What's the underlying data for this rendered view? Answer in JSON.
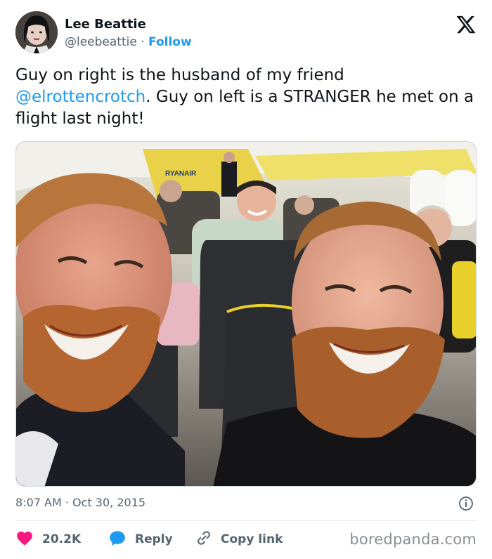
{
  "author": {
    "name": "Lee Beattie",
    "handle": "@leebeattie",
    "separator": "·",
    "follow_label": "Follow"
  },
  "tweet": {
    "text_part1": "Guy on right is the husband of my friend ",
    "mention": "@elrottencrotch",
    "text_part2": ". Guy on left is a STRANGER he met on a flight last night!"
  },
  "meta": {
    "time": "8:07 AM",
    "separator": "·",
    "date": "Oct 30, 2015"
  },
  "actions": {
    "likes": "20.2K",
    "reply": "Reply",
    "copy_link": "Copy link"
  },
  "watermark": "boredpanda.com",
  "photo_text": {
    "airline_sign": "RYANAIR"
  },
  "colors": {
    "accent": "#1d9bf0",
    "like": "#f91880",
    "muted": "#536471"
  },
  "icons": [
    "x-logo-icon",
    "info-icon",
    "heart-icon",
    "reply-bubble-icon",
    "link-icon"
  ]
}
